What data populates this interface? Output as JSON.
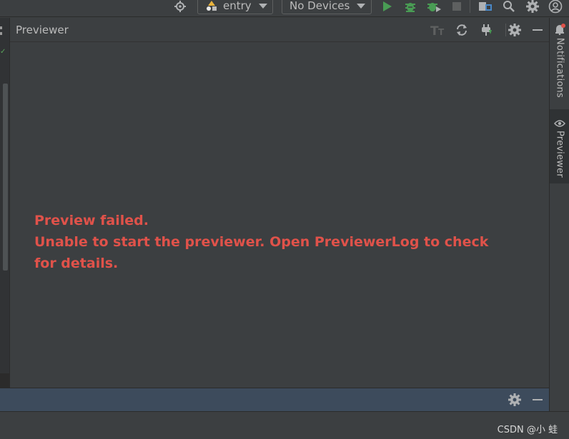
{
  "toolbar": {
    "run_config": "entry",
    "device": "No Devices"
  },
  "previewer": {
    "title": "Previewer",
    "error_line1": "Preview failed.",
    "error_line2": "Unable to start the previewer. Open PreviewerLog to check for details."
  },
  "right_tabs": {
    "notifications": "Notifications",
    "previewer": "Previewer"
  },
  "watermark": "CSDN @小 蛙",
  "colors": {
    "background": "#3c3f41",
    "error_text": "#e0524a",
    "run_green": "#499c54",
    "bottom_bar": "#3d4b5c",
    "notification_badge": "#e0524a"
  },
  "icons": [
    "target-icon",
    "module-icon",
    "run-icon",
    "debug-icon",
    "attach-debugger-icon",
    "stop-icon",
    "project-structure-icon",
    "search-icon",
    "settings-icon",
    "account-icon",
    "font-size-icon",
    "refresh-icon",
    "plug-icon",
    "minimize-icon",
    "bell-icon",
    "eye-icon"
  ]
}
